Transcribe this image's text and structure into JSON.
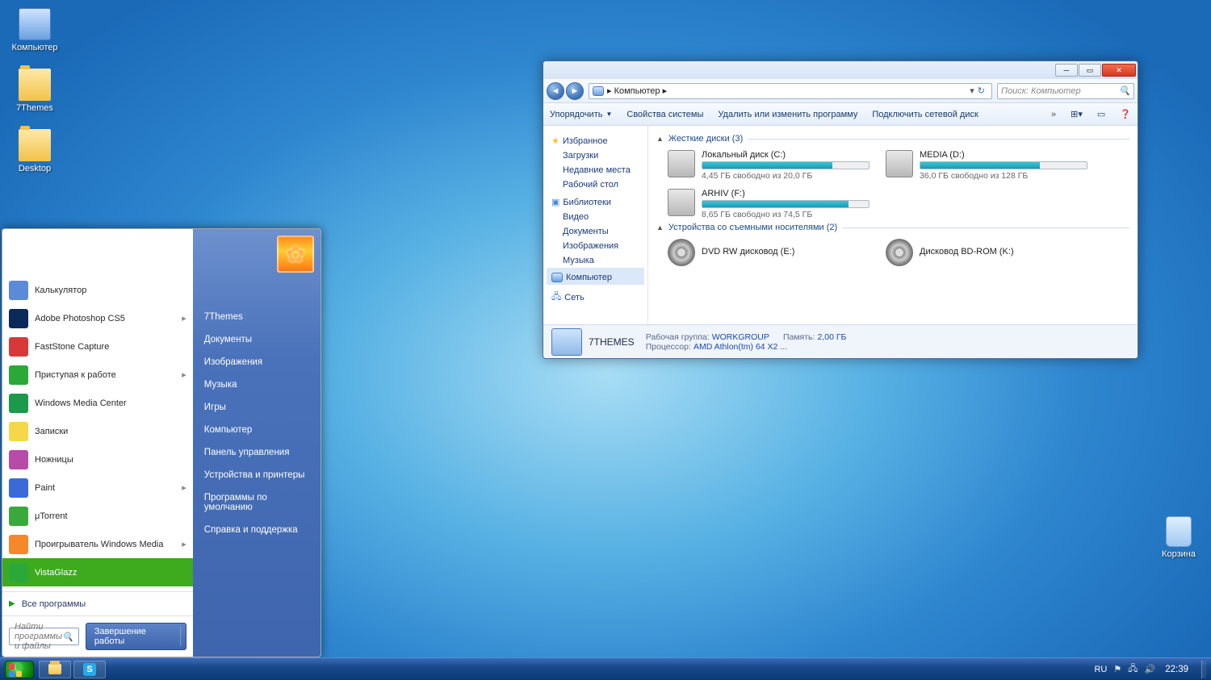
{
  "desktop": {
    "icons": [
      {
        "label": "Компьютер"
      },
      {
        "label": "7Themes"
      },
      {
        "label": "Desktop"
      },
      {
        "label": "Корзина"
      }
    ]
  },
  "startMenu": {
    "programs": [
      {
        "label": "Калькулятор",
        "icon": "#5a8ad8",
        "arrow": false
      },
      {
        "label": "Adobe Photoshop CS5",
        "icon": "#0a2a5a",
        "arrow": true
      },
      {
        "label": "FastStone Capture",
        "icon": "#d83838",
        "arrow": false
      },
      {
        "label": "Приступая к работе",
        "icon": "#2aa838",
        "arrow": true
      },
      {
        "label": "Windows Media Center",
        "icon": "#1a9a4a",
        "arrow": false
      },
      {
        "label": "Записки",
        "icon": "#f5d84a",
        "arrow": false
      },
      {
        "label": "Ножницы",
        "icon": "#b84aa8",
        "arrow": false
      },
      {
        "label": "Paint",
        "icon": "#3a6ad8",
        "arrow": true
      },
      {
        "label": "μTorrent",
        "icon": "#3aa83a",
        "arrow": false
      },
      {
        "label": "Проигрыватель Windows Media",
        "icon": "#f5882a",
        "arrow": true
      },
      {
        "label": "VistaGlazz",
        "icon": "#2aa83a",
        "arrow": false,
        "selected": true
      }
    ],
    "allPrograms": "Все программы",
    "searchPlaceholder": "Найти программы и файлы",
    "shutdown": "Завершение работы",
    "rightLinks": [
      "7Themes",
      "Документы",
      "Изображения",
      "Музыка",
      "Игры",
      "Компьютер",
      "Панель управления",
      "Устройства и принтеры",
      "Программы по умолчанию",
      "Справка и поддержка"
    ]
  },
  "explorer": {
    "addressParts": [
      "Компьютер"
    ],
    "addressArrow": "▸",
    "searchPlaceholder": "Поиск: Компьютер",
    "toolbar": [
      "Упорядочить",
      "Свойства системы",
      "Удалить или изменить программу",
      "Подключить сетевой диск"
    ],
    "sidebar": {
      "fav": {
        "head": "Избранное",
        "items": [
          "Загрузки",
          "Недавние места",
          "Рабочий стол"
        ]
      },
      "lib": {
        "head": "Библиотеки",
        "items": [
          "Видео",
          "Документы",
          "Изображения",
          "Музыка"
        ]
      },
      "comp": "Компьютер",
      "net": "Сеть"
    },
    "categories": {
      "hdd": "Жесткие диски (3)",
      "rem": "Устройства со съемными носителями (2)"
    },
    "drives": [
      {
        "name": "Локальный диск (C:)",
        "free": "4,45 ГБ свободно из 20,0 ГБ",
        "pct": 78
      },
      {
        "name": "MEDIA (D:)",
        "free": "36,0 ГБ свободно из 128 ГБ",
        "pct": 72
      },
      {
        "name": "ARHIV (F:)",
        "free": "8,65 ГБ свободно из 74,5 ГБ",
        "pct": 88
      }
    ],
    "removable": [
      {
        "name": "DVD RW дисковод (E:)"
      },
      {
        "name": "Дисковод BD-ROM (K:)"
      }
    ],
    "status": {
      "name": "7THEMES",
      "workgroupLbl": "Рабочая группа:",
      "workgroup": "WORKGROUP",
      "memLbl": "Память:",
      "mem": "2,00 ГБ",
      "cpuLbl": "Процессор:",
      "cpu": "AMD Athlon(tm) 64 X2 ..."
    }
  },
  "taskbar": {
    "lang": "RU",
    "clock": "22:39"
  }
}
